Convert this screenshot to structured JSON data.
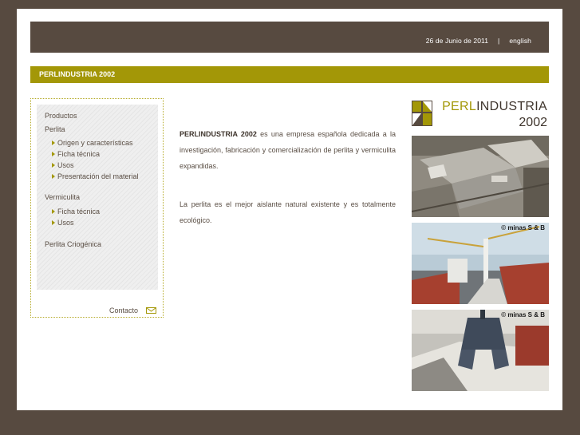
{
  "header": {
    "date": "26 de Junio de 2011",
    "separator": "|",
    "language_link": "english"
  },
  "titlebar": {
    "title": "PERLINDUSTRIA 2002"
  },
  "menu": {
    "productos": "Productos",
    "perlita": "Perlita",
    "perlita_items": [
      "Origen y características",
      "Ficha técnica",
      "Usos",
      "Presentación del material"
    ],
    "vermiculita": "Vermiculita",
    "vermiculita_items": [
      "Ficha técnica",
      "Usos"
    ],
    "criogenica": "Perlita Criogénica",
    "contacto": "Contacto"
  },
  "content": {
    "brand": "PERLINDUSTRIA 2002",
    "p1": " es una empresa española dedicada a la investigación, fabricación y comercialización de perlita y vermiculita expandidas.",
    "p2": "La perlita es el mejor aislante natural existente y es totalmente ecológico."
  },
  "logo": {
    "perl": "PERL",
    "industria": "INDUSTRIA",
    "year": "2002"
  },
  "photos": [
    {
      "name": "factory-photo",
      "credit": ""
    },
    {
      "name": "ship-loading-photo",
      "credit": "© minas S & B"
    },
    {
      "name": "crane-bucket-photo",
      "credit": "© minas S & B"
    }
  ],
  "colors": {
    "accent": "#a39707",
    "dark": "#574a40",
    "text": "#5a4e44"
  }
}
